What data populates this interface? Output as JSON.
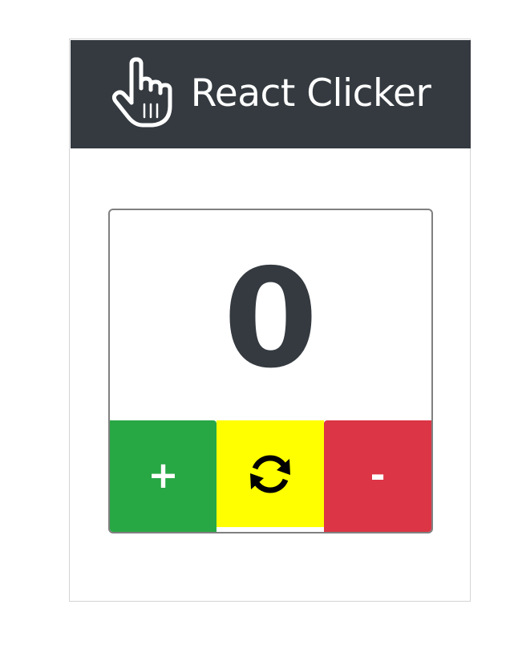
{
  "header": {
    "logo_icon": "pointing-hand-icon",
    "title": "React Clicker",
    "background": "#343a40"
  },
  "counter": {
    "value": "0",
    "color": "#343a40"
  },
  "buttons": {
    "increment": {
      "label": "+",
      "color": "#28a745"
    },
    "reset": {
      "icon": "refresh-icon",
      "color": "#ffff00"
    },
    "decrement": {
      "label": "-",
      "color": "#dc3545"
    }
  }
}
